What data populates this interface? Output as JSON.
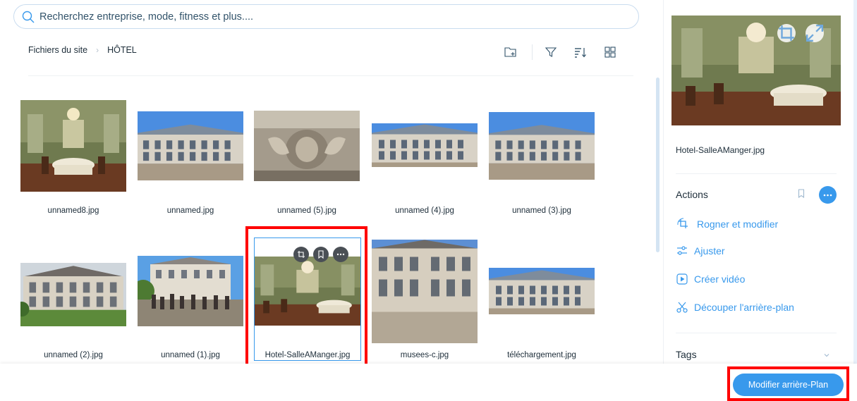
{
  "search": {
    "placeholder": "Recherchez entreprise, mode, fitness et plus...."
  },
  "breadcrumb": {
    "root": "Fichiers du site",
    "current": "HÔTEL",
    "separator": "›"
  },
  "toolbar": {
    "icons": [
      "new-folder-icon",
      "filter-icon",
      "sort-icon",
      "grid-view-icon"
    ]
  },
  "files": [
    {
      "name": "unnamed8.jpg"
    },
    {
      "name": "unnamed.jpg"
    },
    {
      "name": "unnamed (5).jpg"
    },
    {
      "name": "unnamed (4).jpg"
    },
    {
      "name": "unnamed (3).jpg"
    },
    {
      "name": "unnamed (2).jpg"
    },
    {
      "name": "unnamed (1).jpg"
    },
    {
      "name": "Hotel-SalleAManger.jpg",
      "selected": true
    },
    {
      "name": "musees-c.jpg"
    },
    {
      "name": "téléchargement.jpg"
    }
  ],
  "panel": {
    "file_name": "Hotel-SalleAManger.jpg",
    "actions_title": "Actions",
    "actions": [
      {
        "label": "Rogner et modifier",
        "icon": "crop-icon"
      },
      {
        "label": "Ajuster",
        "icon": "adjust-icon"
      },
      {
        "label": "Créer vidéo",
        "icon": "video-icon"
      },
      {
        "label": "Découper l'arrière-plan",
        "icon": "scissors-icon"
      }
    ],
    "tags_title": "Tags"
  },
  "footer": {
    "cta_label": "Modifier arrière-Plan"
  },
  "colors": {
    "accent": "#3899ec",
    "highlight_box": "#ff0000",
    "text": "#20303c"
  }
}
